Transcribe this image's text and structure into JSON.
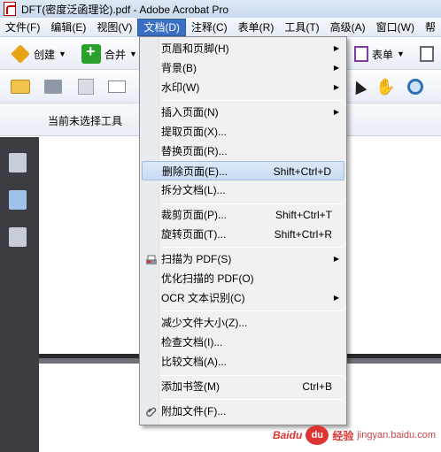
{
  "window": {
    "title": "DFT(密度泛函理论).pdf - Adobe Acrobat Pro"
  },
  "menubar": [
    {
      "label": "文件(F)"
    },
    {
      "label": "编辑(E)"
    },
    {
      "label": "视图(V)"
    },
    {
      "label": "文档(D)",
      "active": true
    },
    {
      "label": "注释(C)"
    },
    {
      "label": "表单(R)"
    },
    {
      "label": "工具(T)"
    },
    {
      "label": "高级(A)"
    },
    {
      "label": "窗口(W)"
    },
    {
      "label": "帮"
    }
  ],
  "toolbar": {
    "create_label": "创建",
    "combine_label": "合并",
    "form_label": "表单",
    "status_label": "当前未选择工具"
  },
  "dropdown": {
    "items": [
      {
        "label": "页眉和页脚(H)",
        "submenu": true
      },
      {
        "label": "背景(B)",
        "submenu": true
      },
      {
        "label": "水印(W)",
        "submenu": true
      },
      {
        "label": "插入页面(N)",
        "submenu": true
      },
      {
        "label": "提取页面(X)..."
      },
      {
        "label": "替换页面(R)..."
      },
      {
        "label": "删除页面(E)...",
        "shortcut": "Shift+Ctrl+D",
        "highlighted": true
      },
      {
        "label": "拆分文档(L)..."
      },
      {
        "label": "裁剪页面(P)...",
        "shortcut": "Shift+Ctrl+T"
      },
      {
        "label": "旋转页面(T)...",
        "shortcut": "Shift+Ctrl+R"
      },
      {
        "label": "扫描为 PDF(S)",
        "submenu": true,
        "icon": "scanner-icon"
      },
      {
        "label": "优化扫描的 PDF(O)"
      },
      {
        "label": "OCR 文本识别(C)",
        "submenu": true
      },
      {
        "label": "减少文件大小(Z)..."
      },
      {
        "label": "检查文档(I)..."
      },
      {
        "label": "比较文档(A)..."
      },
      {
        "label": "添加书签(M)",
        "shortcut": "Ctrl+B"
      },
      {
        "label": "附加文件(F)...",
        "icon": "paperclip-icon"
      }
    ]
  },
  "watermark": {
    "brand": "Baidu",
    "suffix": "经验",
    "site": "jingyan.baidu.com"
  }
}
